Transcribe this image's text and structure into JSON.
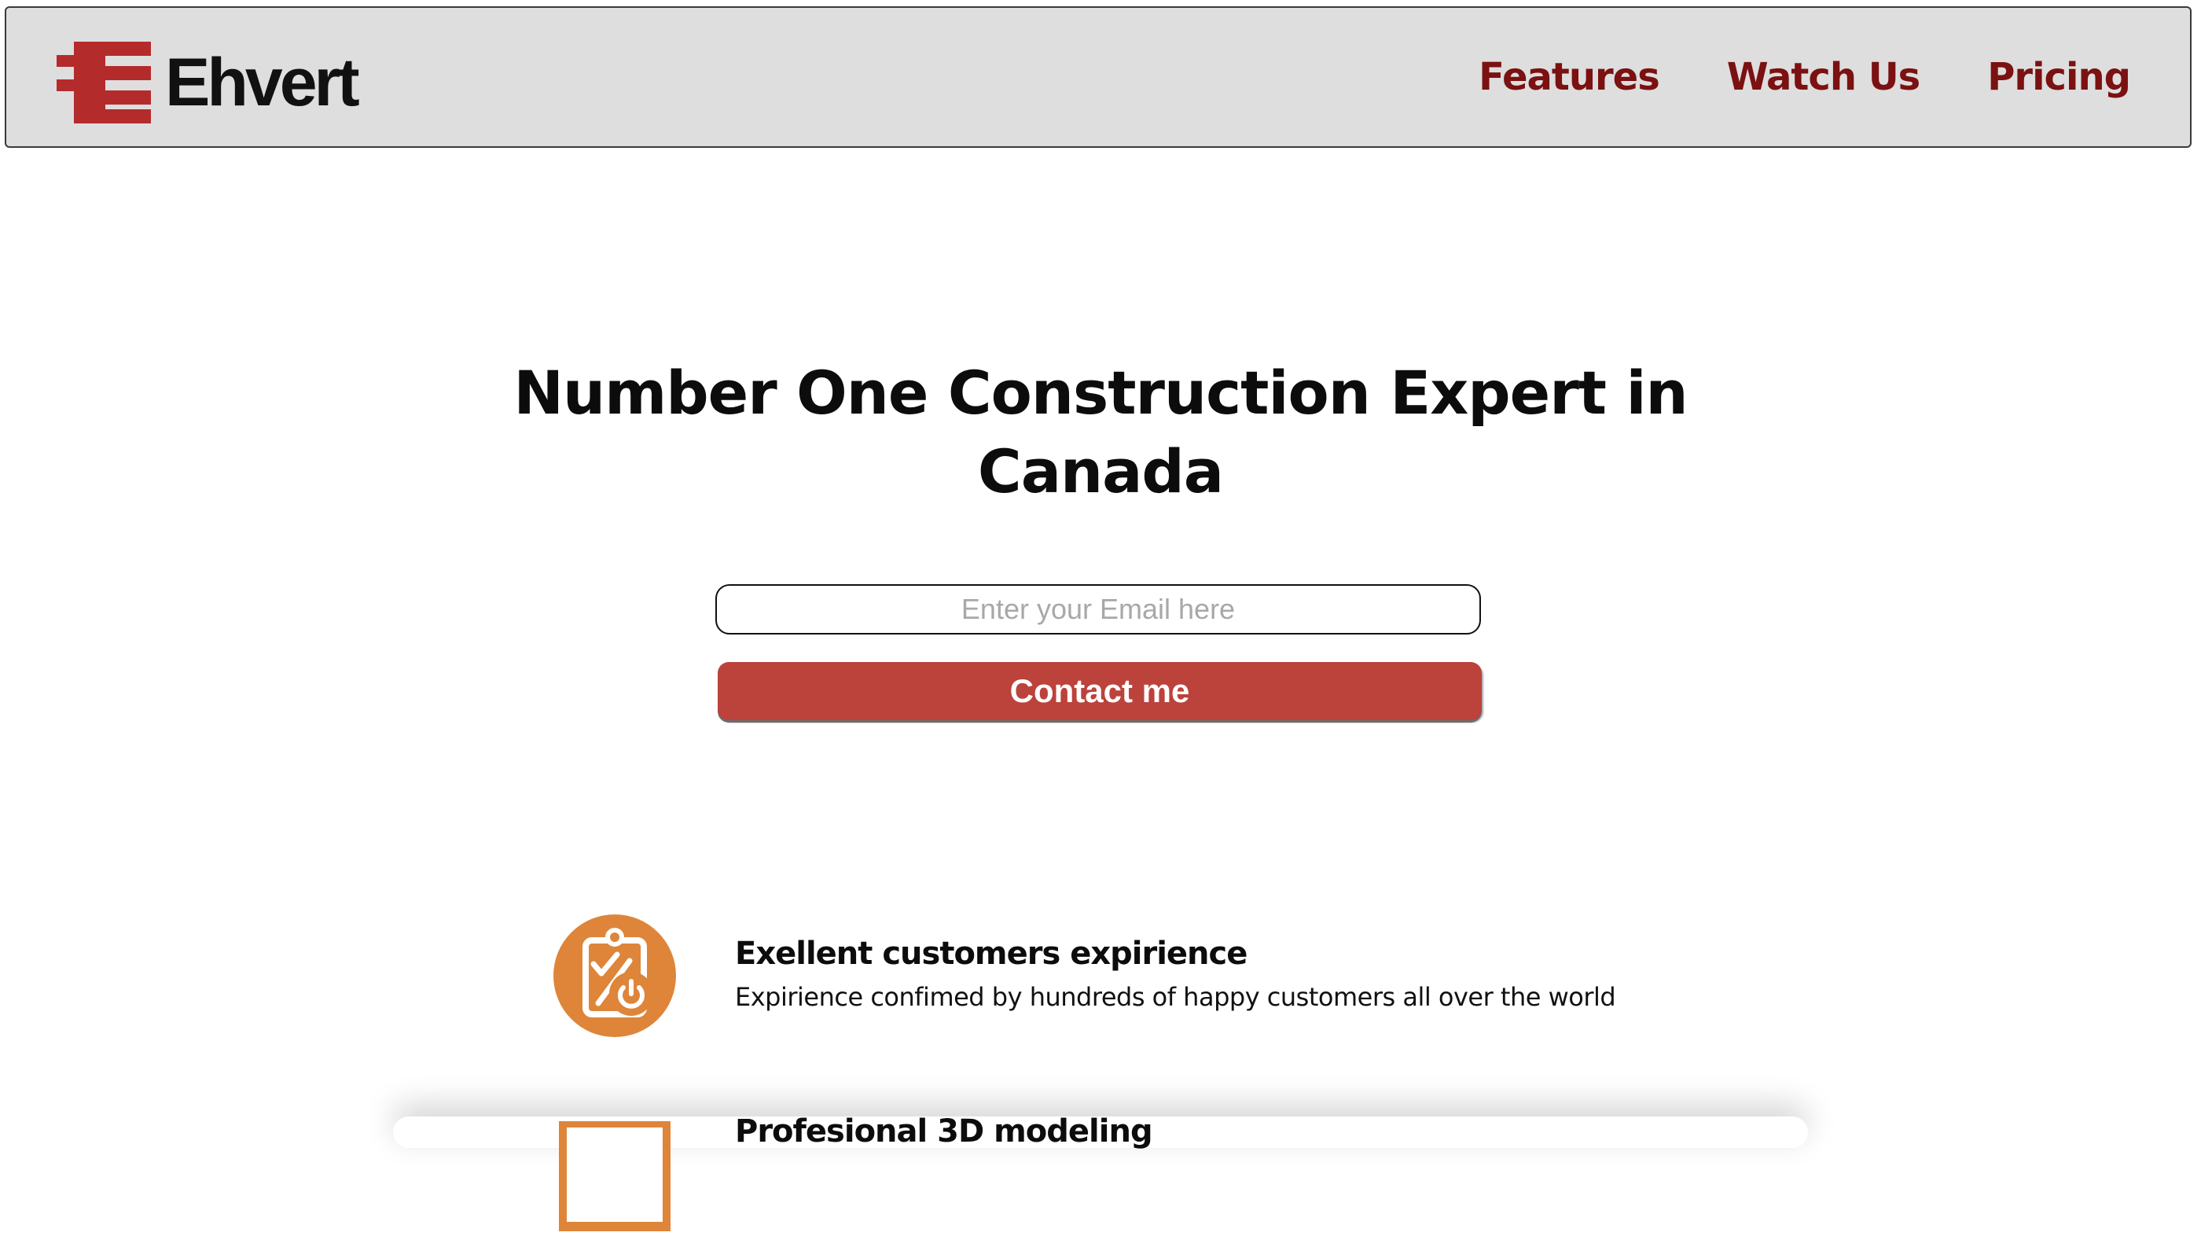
{
  "brand": {
    "name": "Ehvert",
    "accent": "#b42b2b"
  },
  "nav": {
    "items": [
      {
        "label": "Features"
      },
      {
        "label": "Watch Us"
      },
      {
        "label": "Pricing"
      }
    ],
    "link_color": "#7b1111"
  },
  "hero": {
    "title": "Number One Construction Expert in Canada",
    "email_placeholder": "Enter your Email here",
    "email_value": "",
    "button_label": "Contact me",
    "button_color": "#bc423c"
  },
  "features": [
    {
      "icon": "clipboard-power-icon",
      "title": "Exellent customers expirience",
      "description": "Expirience confimed by hundreds of happy customers all over the world"
    },
    {
      "icon": "frame-icon",
      "title": "Profesional 3D modeling",
      "description": ""
    }
  ],
  "feature_icon_color": "#de853a"
}
